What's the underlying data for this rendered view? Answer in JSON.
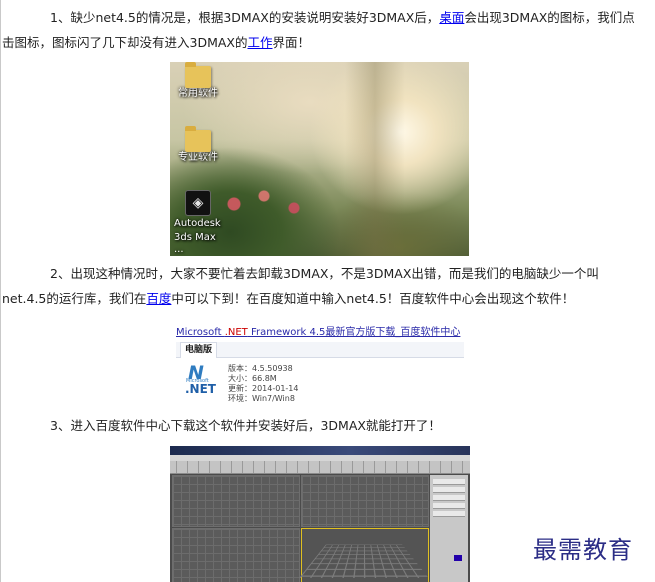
{
  "paragraphs": {
    "p1": {
      "text_before_link1": "1、缺少net4.5的情况是，根据3DMAX的安装说明安装好3DMAX后，",
      "link1": "桌面",
      "text_after_link1": "会出现3DMAX的图标，我们点击图标，图标闪了几下却没有进入3DMAX的",
      "link2": "工作",
      "text_end": "界面！"
    },
    "p2": {
      "text_before_link": "2、出现这种情况时，大家不要忙着去卸载3DMAX，不是3DMAX出错，而是我们的电脑缺少一个叫net.4.5的运行库，我们在",
      "link": "百度",
      "text_after_link": "中可以下到！在百度知道中输入net4.5！百度软件中心会出现这个软件！"
    },
    "p3": {
      "text": "3、进入百度软件中心下载这个软件并安装好后，3DMAX就能打开了！"
    }
  },
  "desktop_screenshot": {
    "icons": [
      {
        "label": "常用软件",
        "icon": "folder-icon"
      },
      {
        "label": "专业软件",
        "icon": "folder-icon"
      },
      {
        "label_line1": "Autodesk",
        "label_line2": "3ds Max ...",
        "icon": "3dsmax-icon"
      }
    ]
  },
  "listing_screenshot": {
    "title_part1": "Microsoft ",
    "title_red": ".NET",
    "title_part2": " Framework 4.5最新官方版下载_百度软件中心",
    "tab": "电脑版",
    "logo_small": "Microsoft",
    "logo_word": ".NET",
    "specs": [
      "版本：4.5.50938",
      "大小：66.8M",
      "更新：2014-01-14",
      "环境：Win7/Win8"
    ]
  },
  "watermark": "最需教育",
  "colors": {
    "link": "#0000ee",
    "watermark": "#2b2d86",
    "text": "#222222"
  }
}
